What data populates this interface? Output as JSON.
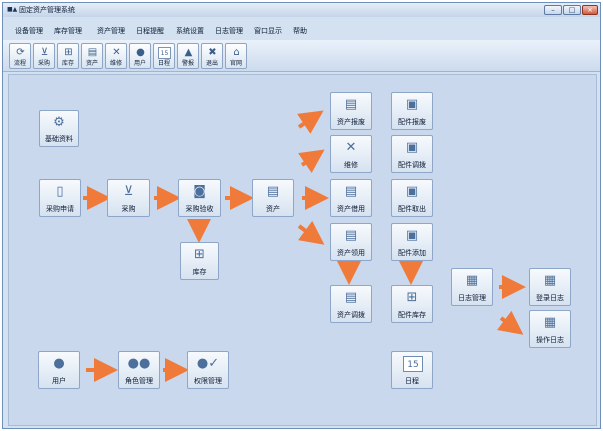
{
  "window": {
    "title": "固定资产管理系统",
    "app_icon_text": "■▲",
    "buttons": {
      "minimize": "–",
      "maximize": "□",
      "close": "×"
    }
  },
  "menu": [
    {
      "label": "设备管理"
    },
    {
      "label": "库存管理"
    },
    {
      "label": "资产管理"
    },
    {
      "label": "日程提醒"
    },
    {
      "label": "系统设置"
    },
    {
      "label": "日志管理"
    },
    {
      "label": "窗口显示"
    },
    {
      "label": "帮助"
    }
  ],
  "toolbar": [
    {
      "label": "流程",
      "icon": "workflow-icon"
    },
    {
      "label": "采购",
      "icon": "cart-icon"
    },
    {
      "label": "库存",
      "icon": "warehouse-icon"
    },
    {
      "label": "资产",
      "icon": "asset-icon"
    },
    {
      "label": "维修",
      "icon": "wrench-icon"
    },
    {
      "label": "用户",
      "icon": "user-icon"
    },
    {
      "label": "日程",
      "icon": "calendar-icon",
      "badge": "15"
    },
    {
      "label": "警报",
      "icon": "bell-icon"
    },
    {
      "label": "退出",
      "icon": "exit-icon"
    },
    {
      "label": "官网",
      "icon": "home-icon"
    }
  ],
  "flow": {
    "basic_data": {
      "label": "基础资料",
      "icon": "gear-document-icon"
    },
    "purchase_request": {
      "label": "采购申请",
      "icon": "document-icon"
    },
    "purchase": {
      "label": "采购",
      "icon": "cart-icon"
    },
    "purchase_accept": {
      "label": "采购验收",
      "icon": "floppy-icon"
    },
    "inventory": {
      "label": "库存",
      "icon": "hierarchy-icon"
    },
    "asset": {
      "label": "资产",
      "icon": "asset-icon"
    },
    "asset_scrap": {
      "label": "资产报废",
      "icon": "asset-scrap-icon"
    },
    "repair": {
      "label": "维修",
      "icon": "wrench-icon"
    },
    "asset_borrow": {
      "label": "资产借用",
      "icon": "asset-borrow-icon"
    },
    "asset_collect": {
      "label": "资产领用",
      "icon": "asset-collect-icon"
    },
    "asset_transfer": {
      "label": "资产调拨",
      "icon": "asset-transfer-icon"
    },
    "part_scrap": {
      "label": "配件报废",
      "icon": "part-scrap-icon"
    },
    "part_transfer": {
      "label": "配件调拨",
      "icon": "part-transfer-icon"
    },
    "part_remove": {
      "label": "配件取出",
      "icon": "part-remove-icon"
    },
    "part_add": {
      "label": "配件添加",
      "icon": "part-add-icon"
    },
    "part_inventory": {
      "label": "配件库存",
      "icon": "part-inventory-icon"
    },
    "log_manage": {
      "label": "日志管理",
      "icon": "log-icon"
    },
    "login_log": {
      "label": "登录日志",
      "icon": "login-log-icon"
    },
    "operation_log": {
      "label": "操作日志",
      "icon": "operation-log-icon"
    },
    "user": {
      "label": "用户",
      "icon": "user-icon"
    },
    "role_manage": {
      "label": "角色管理",
      "icon": "users-icon"
    },
    "permission_manage": {
      "label": "权限管理",
      "icon": "permission-icon"
    },
    "schedule": {
      "label": "日程",
      "icon": "calendar-icon",
      "badge": "15"
    }
  },
  "colors": {
    "arrow": "#f07a3a",
    "canvas": "#c9d8ed",
    "node_border": "#8ea6c8"
  }
}
